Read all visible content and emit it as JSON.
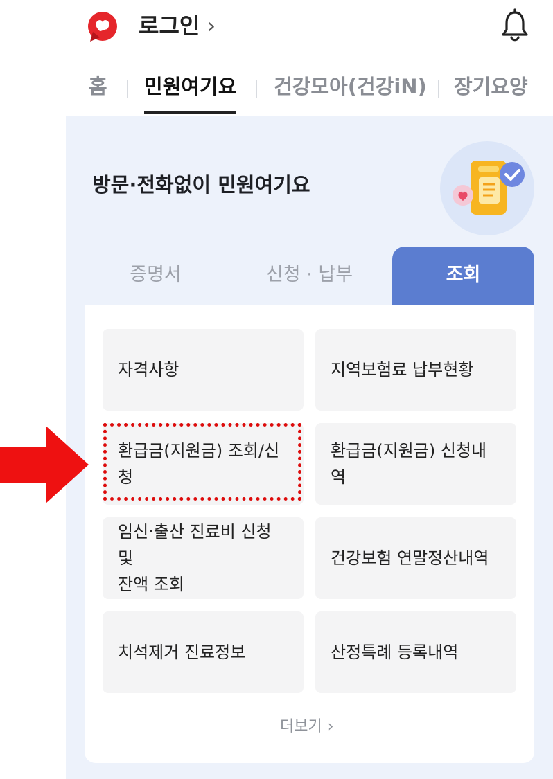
{
  "header": {
    "logo_icon": "heart-logo-icon",
    "login_label": "로그인",
    "login_chevron": "›",
    "notification_icon": "bell-icon"
  },
  "main_tabs": [
    {
      "label": "홈",
      "active": false
    },
    {
      "label": "민원여기요",
      "active": true
    },
    {
      "label": "건강모아(건강iN)",
      "active": false
    },
    {
      "label": "장기요양",
      "active": false
    }
  ],
  "panel": {
    "title": "방문·전화없이 민원여기요",
    "illustration_icon": "phone-document-check-icon",
    "sub_tabs": [
      {
        "label": "증명서",
        "active": false
      },
      {
        "label": "신청 · 납부",
        "active": false
      },
      {
        "label": "조회",
        "active": true
      }
    ],
    "items": [
      {
        "label": "자격사항"
      },
      {
        "label": "지역보험료 납부현황"
      },
      {
        "label": "환급금(지원금) 조회/신청",
        "highlighted": true
      },
      {
        "label": "환급금(지원금) 신청내역"
      },
      {
        "label": "임신·출산 진료비 신청 및\n잔액 조회"
      },
      {
        "label": "건강보험 연말정산내역"
      },
      {
        "label": "치석제거 진료정보"
      },
      {
        "label": "산정특례 등록내역"
      }
    ],
    "more_label": "더보기",
    "more_chevron": "›"
  },
  "annotation": {
    "arrow_icon": "red-arrow-right-icon",
    "color": "#ee1111"
  }
}
